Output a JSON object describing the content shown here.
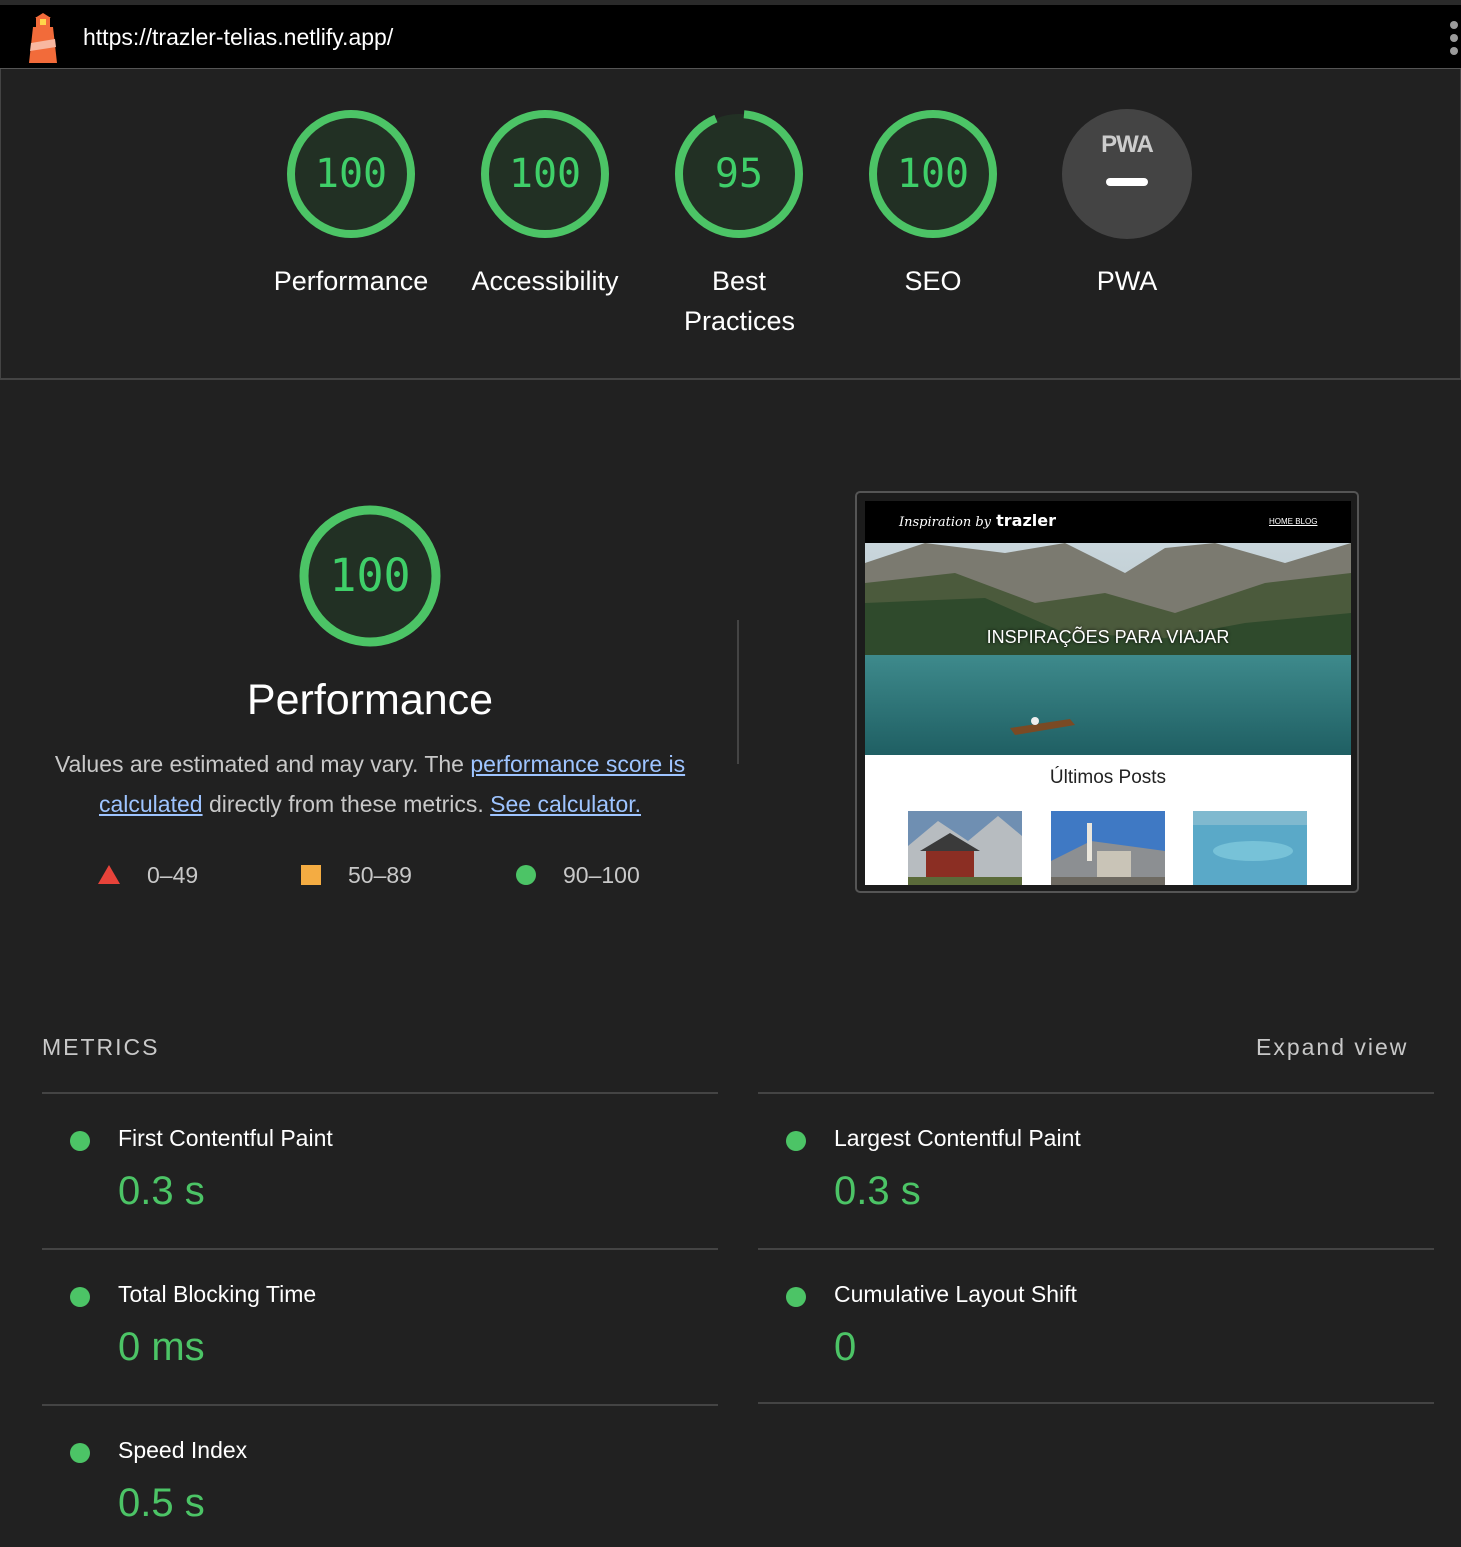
{
  "topbar": {
    "url": "https://trazler-telias.netlify.app/"
  },
  "colors": {
    "pass": "#4cc466",
    "average": "#f4ac42",
    "fail": "#e8433a",
    "background": "#212121"
  },
  "gauges": [
    {
      "score": "100",
      "score_value": 100,
      "label": "Performance"
    },
    {
      "score": "100",
      "score_value": 100,
      "label": "Accessibility"
    },
    {
      "score": "95",
      "score_value": 95,
      "label": "Best Practices"
    },
    {
      "score": "100",
      "score_value": 100,
      "label": "SEO"
    },
    {
      "badge_text": "PWA",
      "label": "PWA"
    }
  ],
  "performance": {
    "score": "100",
    "title": "Performance",
    "desc_prefix": "Values are estimated and may vary. The ",
    "desc_link1": "performance score is calculated",
    "desc_middle": " directly from these metrics. ",
    "desc_link2": "See calculator.",
    "legend": [
      {
        "shape": "triangle",
        "range": "0–49"
      },
      {
        "shape": "square",
        "range": "50–89"
      },
      {
        "shape": "circle",
        "range": "90–100"
      }
    ]
  },
  "screenshot": {
    "brand_script": "Inspiration by",
    "brand_name": "trazler",
    "nav_links": "HOME  BLOG",
    "hero_title": "INSPIRAÇÕES PARA VIAJAR",
    "posts_title": "Últimos Posts"
  },
  "metrics": {
    "header": "METRICS",
    "expand_label": "Expand view",
    "items": [
      {
        "name": "First Contentful Paint",
        "value": "0.3 s"
      },
      {
        "name": "Largest Contentful Paint",
        "value": "0.3 s"
      },
      {
        "name": "Total Blocking Time",
        "value": "0 ms"
      },
      {
        "name": "Cumulative Layout Shift",
        "value": "0"
      },
      {
        "name": "Speed Index",
        "value": "0.5 s"
      }
    ]
  }
}
